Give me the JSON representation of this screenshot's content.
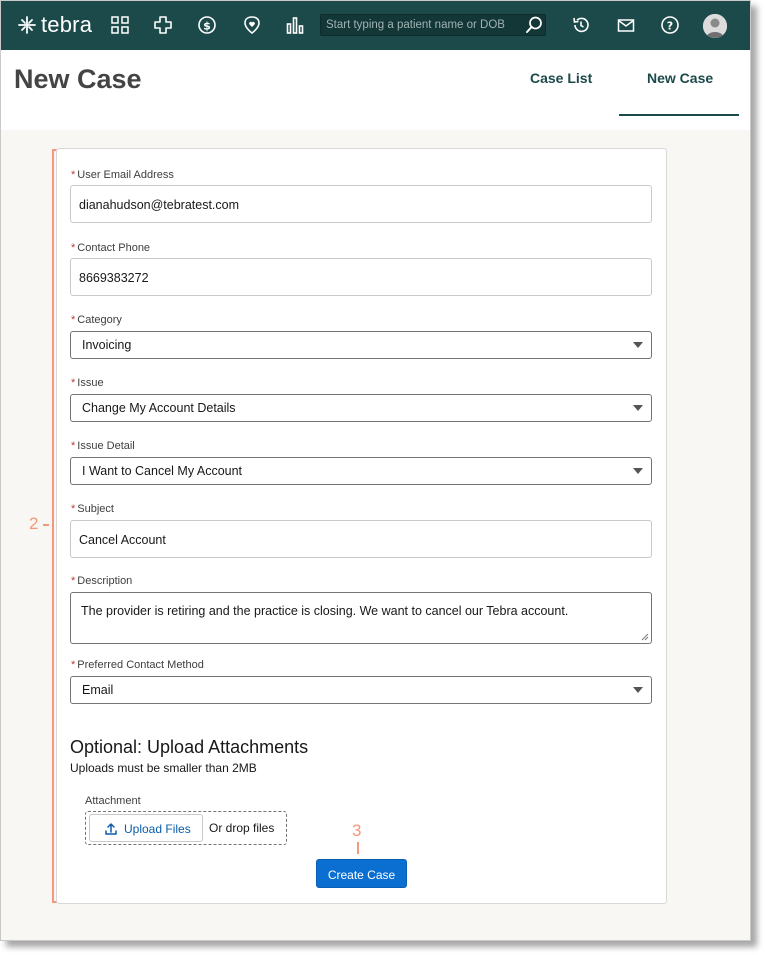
{
  "app": {
    "logo_text": "tebra",
    "brand_color": "#1c4a4b",
    "annotation_color": "#f4977a",
    "primary_button_color": "#0b6fd2"
  },
  "topbar": {
    "icons": [
      "grid-icon",
      "plus-icon",
      "dollar-icon",
      "heart-shield-icon",
      "bar-chart-icon",
      "history-icon",
      "mail-icon",
      "help-icon"
    ],
    "search_placeholder": "Start typing a patient name or DOB"
  },
  "header": {
    "title": "New Case",
    "tabs": [
      {
        "label": "Case List",
        "active": false
      },
      {
        "label": "New Case",
        "active": true
      }
    ]
  },
  "annotations": {
    "step2": "2-",
    "step3": "3"
  },
  "form": {
    "required_mark": "*",
    "user_email": {
      "label": "User Email Address",
      "value": "dianahudson@tebratest.com"
    },
    "contact_phone": {
      "label": "Contact Phone",
      "value": "8669383272"
    },
    "category": {
      "label": "Category",
      "value": "Invoicing"
    },
    "issue": {
      "label": "Issue",
      "value": "Change My Account Details"
    },
    "issue_detail": {
      "label": "Issue Detail",
      "value": "I Want to Cancel My Account"
    },
    "subject": {
      "label": "Subject",
      "value": "Cancel Account"
    },
    "description": {
      "label": "Description",
      "value": "The provider is retiring and the practice is closing. We want to cancel our Tebra account."
    },
    "preferred_contact": {
      "label": "Preferred Contact Method",
      "value": "Email"
    }
  },
  "attachments": {
    "title": "Optional: Upload Attachments",
    "subtitle": "Uploads must be smaller than 2MB",
    "label": "Attachment",
    "upload_button": "Upload Files",
    "drop_text": "Or drop files"
  },
  "submit": {
    "label": "Create Case"
  }
}
